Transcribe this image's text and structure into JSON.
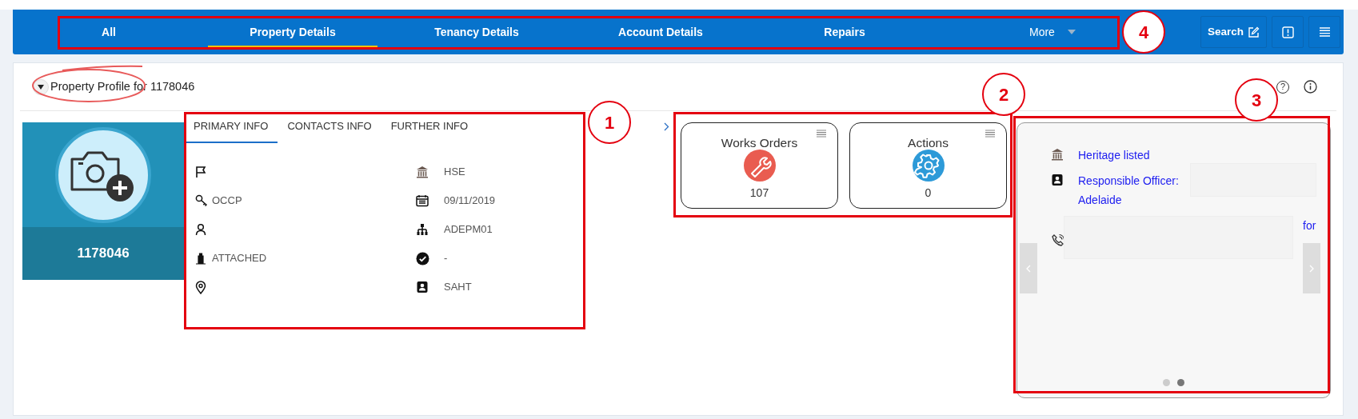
{
  "nav": {
    "tabs": [
      {
        "label": "All",
        "selected": false
      },
      {
        "label": "Property Details",
        "selected": true
      },
      {
        "label": "Tenancy Details",
        "selected": false
      },
      {
        "label": "Account Details",
        "selected": false
      },
      {
        "label": "Repairs",
        "selected": false
      }
    ],
    "more": {
      "label": "More"
    },
    "search_button": {
      "label": "Search"
    }
  },
  "header": {
    "title": "Property Profile for 1178046",
    "help_label": "?"
  },
  "photo_tile": {
    "reference": "1178046"
  },
  "info_panel": {
    "tabs": [
      {
        "label": "PRIMARY INFO",
        "selected": true
      },
      {
        "label": "CONTACTS INFO",
        "selected": false
      },
      {
        "label": "FURTHER INFO",
        "selected": false
      }
    ],
    "left": [
      {
        "kind": "flag"
      },
      {
        "kind": "key",
        "value": "OCCP"
      },
      {
        "kind": "person"
      },
      {
        "kind": "building",
        "value": "ATTACHED"
      },
      {
        "kind": "pin"
      }
    ],
    "right": [
      {
        "kind": "bank",
        "value": "HSE"
      },
      {
        "kind": "calendar",
        "value": "09/11/2019"
      },
      {
        "kind": "hierarchy",
        "value": "ADEPM01"
      },
      {
        "kind": "check",
        "value": "-"
      },
      {
        "kind": "contact",
        "value": "SAHT"
      }
    ]
  },
  "summary_cards": [
    {
      "kind": "wrench",
      "title": "Works Orders",
      "count": "107"
    },
    {
      "kind": "gear",
      "title": "Actions",
      "count": "0"
    }
  ],
  "carousel": {
    "items": [
      {
        "kind": "bank",
        "text": "Heritage listed"
      },
      {
        "kind": "contact",
        "text": "Responsible Officer: Adelaide"
      },
      {
        "kind": "phone",
        "text": "for"
      }
    ],
    "dots": [
      {
        "selected": false
      },
      {
        "selected": true
      }
    ]
  },
  "annotations": [
    {
      "number": "4"
    },
    {
      "number": "2"
    },
    {
      "number": "3"
    },
    {
      "number": "1"
    }
  ]
}
